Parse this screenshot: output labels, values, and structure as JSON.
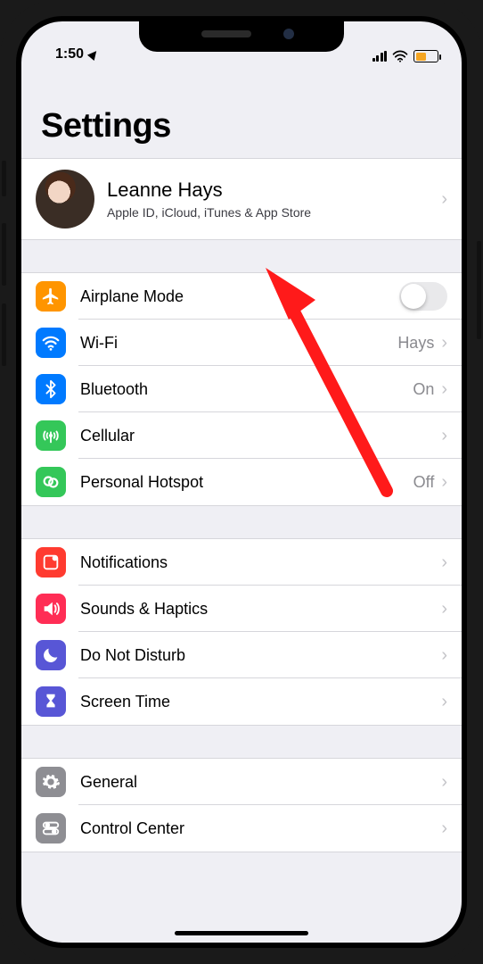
{
  "statusbar": {
    "time": "1:50"
  },
  "title": "Settings",
  "profile": {
    "name": "Leanne Hays",
    "subtitle": "Apple ID, iCloud, iTunes & App Store"
  },
  "group1": [
    {
      "label": "Airplane Mode",
      "icon": "airplane",
      "bg": "#ff9500",
      "control": "toggle",
      "on": false
    },
    {
      "label": "Wi-Fi",
      "icon": "wifi",
      "bg": "#007aff",
      "value": "Hays",
      "chevron": true
    },
    {
      "label": "Bluetooth",
      "icon": "bluetooth",
      "bg": "#007aff",
      "value": "On",
      "chevron": true
    },
    {
      "label": "Cellular",
      "icon": "cellular",
      "bg": "#34c759",
      "chevron": true
    },
    {
      "label": "Personal Hotspot",
      "icon": "hotspot",
      "bg": "#34c759",
      "value": "Off",
      "chevron": true
    }
  ],
  "group2": [
    {
      "label": "Notifications",
      "icon": "notifications",
      "bg": "#ff3b30",
      "chevron": true
    },
    {
      "label": "Sounds & Haptics",
      "icon": "sounds",
      "bg": "#ff2d55",
      "chevron": true
    },
    {
      "label": "Do Not Disturb",
      "icon": "moon",
      "bg": "#5856d6",
      "chevron": true
    },
    {
      "label": "Screen Time",
      "icon": "hourglass",
      "bg": "#5856d6",
      "chevron": true
    }
  ],
  "group3": [
    {
      "label": "General",
      "icon": "gear",
      "bg": "#8e8e93",
      "chevron": true
    },
    {
      "label": "Control Center",
      "icon": "toggles",
      "bg": "#8e8e93",
      "chevron": true
    }
  ]
}
